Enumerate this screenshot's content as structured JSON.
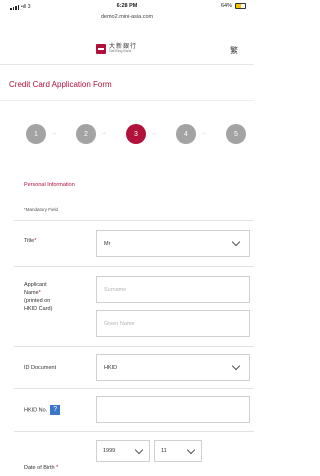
{
  "status_bar": {
    "signal": "•ıll 3",
    "time": "6:28 PM",
    "battery": "64%"
  },
  "url": "demo2.mini-asia.com",
  "brand": {
    "logo_cn": "大新銀行",
    "logo_en": "DahSing Bank",
    "lang_toggle": "繁"
  },
  "form_title": "Credit Card Application Form",
  "steps": [
    {
      "number": "1",
      "active": false
    },
    {
      "number": "2",
      "active": false
    },
    {
      "number": "3",
      "active": true
    },
    {
      "number": "4",
      "active": false
    },
    {
      "number": "5",
      "active": false
    }
  ],
  "step_arrow": "→",
  "section_title": "Personal Information",
  "mandatory_note": "*Mandatory Field",
  "fields": {
    "title": {
      "label": "Title",
      "required_mark": "*",
      "value": "Mr"
    },
    "applicant_name": {
      "label_line1": "Applicant",
      "label_line2": "Name",
      "required_mark": "*",
      "label_line3": "(printed on",
      "label_line4": "HKID Card)",
      "surname_placeholder": "Surname",
      "given_name_placeholder": "Given Name"
    },
    "id_document": {
      "label": "ID Document",
      "value": "HKID"
    },
    "hkid_no": {
      "label": "HKID No.",
      "help_icon": "?",
      "value": ""
    },
    "date_of_birth": {
      "label": "Date of Birth",
      "required_mark": "*",
      "year": "1999",
      "month": "11",
      "day": ""
    }
  },
  "colors": {
    "accent": "#b0123b",
    "step_inactive": "#a3a3a3",
    "help_icon": "#3a77c8"
  }
}
